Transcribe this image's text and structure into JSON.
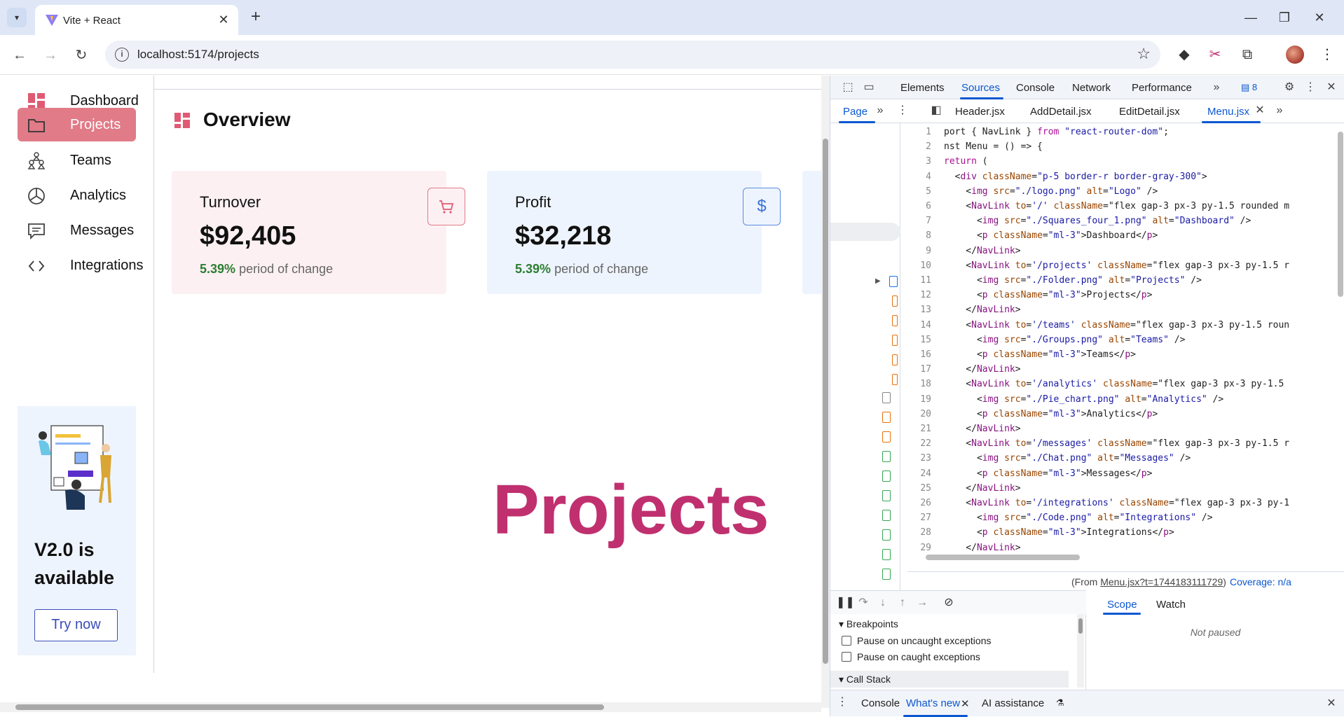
{
  "browser": {
    "tab_title": "Vite + React",
    "url": "localhost:5174/projects"
  },
  "sidebar": {
    "items": [
      {
        "label": "Dashboard",
        "icon": "dashboard-icon",
        "active": false
      },
      {
        "label": "Projects",
        "icon": "folder-icon",
        "active": true
      },
      {
        "label": "Teams",
        "icon": "teams-icon",
        "active": false
      },
      {
        "label": "Analytics",
        "icon": "pie-chart-icon",
        "active": false
      },
      {
        "label": "Messages",
        "icon": "chat-icon",
        "active": false
      },
      {
        "label": "Integrations",
        "icon": "code-icon",
        "active": false
      }
    ],
    "promo": {
      "title": "V2.0 is available",
      "button": "Try now"
    }
  },
  "main": {
    "title": "Overview",
    "cards": [
      {
        "label": "Turnover",
        "value": "$92,405",
        "change_pct": "5.39%",
        "change_text": "period of change",
        "icon": "cart-icon"
      },
      {
        "label": "Profit",
        "value": "$32,218",
        "change_pct": "5.39%",
        "change_text": "period of change",
        "icon": "dollar-icon"
      }
    ],
    "page_heading": "Projects"
  },
  "devtools": {
    "tabs": [
      "Elements",
      "Sources",
      "Console",
      "Network",
      "Performance"
    ],
    "active_tab": "Sources",
    "issues_count": "8",
    "navigator_tab": "Page",
    "file_tabs": [
      "Header.jsx",
      "AddDetail.jsx",
      "EditDetail.jsx",
      "Menu.jsx"
    ],
    "active_file": "Menu.jsx",
    "code_lines": [
      "port { NavLink } from \"react-router-dom\";",
      "nst Menu = () => {",
      "return (",
      "  <div className=\"p-5 border-r border-gray-300\">",
      "    <img src=\"./logo.png\" alt=\"Logo\" />",
      "    <NavLink to='/' className=\"flex gap-3 px-3 py-1.5 rounded m",
      "      <img src=\"./Squares_four_1.png\" alt=\"Dashboard\" />",
      "      <p className=\"ml-3\">Dashboard</p>",
      "    </NavLink>",
      "    <NavLink to='/projects' className=\"flex gap-3 px-3 py-1.5 r",
      "      <img src=\"./Folder.png\" alt=\"Projects\" />",
      "      <p className=\"ml-3\">Projects</p>",
      "    </NavLink>",
      "    <NavLink to='/teams' className=\"flex gap-3 px-3 py-1.5 roun",
      "      <img src=\"./Groups.png\" alt=\"Teams\" />",
      "      <p className=\"ml-3\">Teams</p>",
      "    </NavLink>",
      "    <NavLink to='/analytics' className=\"flex gap-3 px-3 py-1.5",
      "      <img src=\"./Pie_chart.png\" alt=\"Analytics\" />",
      "      <p className=\"ml-3\">Analytics</p>",
      "    </NavLink>",
      "    <NavLink to='/messages' className=\"flex gap-3 px-3 py-1.5 r",
      "      <img src=\"./Chat.png\" alt=\"Messages\" />",
      "      <p className=\"ml-3\">Messages</p>",
      "    </NavLink>",
      "    <NavLink to='/integrations' className=\"flex gap-3 px-3 py-1",
      "      <img src=\"./Code.png\" alt=\"Integrations\" />",
      "      <p className=\"ml-3\">Integrations</p>",
      "    </NavLink>"
    ],
    "status_from": "(From ",
    "status_from_link": "Menu.jsx?t=1744183111729",
    "status_from_end": ")",
    "coverage": "Coverage: n/a",
    "breakpoints": {
      "title": "Breakpoints",
      "uncaught": "Pause on uncaught exceptions",
      "caught": "Pause on caught exceptions",
      "call_stack": "Call Stack"
    },
    "scope_tabs": [
      "Scope",
      "Watch"
    ],
    "not_paused": "Not paused",
    "drawer_tabs": [
      "Console",
      "What's new",
      "AI assistance"
    ]
  },
  "colors": {
    "active_menu": "#e07b87",
    "accent_pink": "#c0306f",
    "devtools_blue": "#0b57d0",
    "positive_green": "#2e7d32"
  }
}
